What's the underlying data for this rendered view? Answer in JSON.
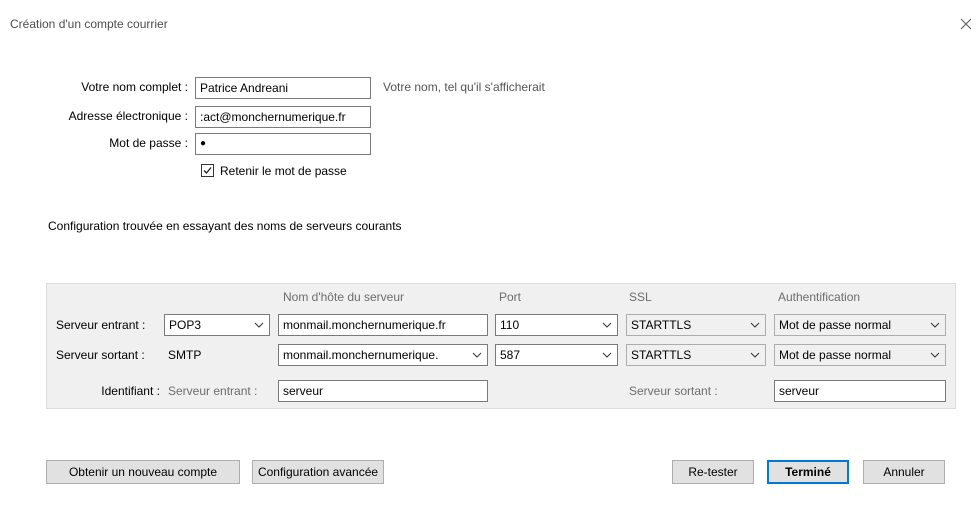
{
  "window": {
    "title": "Création d'un compte courrier"
  },
  "form": {
    "name_label": "Votre nom complet :",
    "name_value": "Patrice Andreani",
    "name_hint": "Votre nom, tel qu'il s'afficherait",
    "email_label": "Adresse électronique :",
    "email_value": ":act@monchernumerique.fr",
    "password_label": "Mot de passe :",
    "password_value": "●",
    "remember_label": "Retenir le mot de passe",
    "remember_checked": true
  },
  "status_message": "Configuration trouvée en essayant des noms de serveurs courants",
  "servers": {
    "headers": {
      "hostname": "Nom d'hôte du serveur",
      "port": "Port",
      "ssl": "SSL",
      "auth": "Authentification"
    },
    "incoming": {
      "label": "Serveur entrant :",
      "protocol": "POP3",
      "hostname": "monmail.monchernumerique.fr",
      "port": "110",
      "ssl": "STARTTLS",
      "auth": "Mot de passe normal"
    },
    "outgoing": {
      "label": "Serveur sortant :",
      "protocol": "SMTP",
      "hostname": "monmail.monchernumerique.",
      "port": "587",
      "ssl": "STARTTLS",
      "auth": "Mot de passe normal"
    },
    "identifier": {
      "label": "Identifiant :",
      "incoming_label": "Serveur entrant :",
      "incoming_value": "serveur",
      "outgoing_label": "Serveur sortant :",
      "outgoing_value": "serveur"
    }
  },
  "buttons": {
    "new_account": "Obtenir un nouveau compte",
    "advanced": "Configuration avancée",
    "retest": "Re-tester",
    "done": "Terminé",
    "cancel": "Annuler"
  },
  "icons": {
    "close": "close-icon",
    "dropdown": "chevron-down-icon",
    "checkbox": "checkmark-icon"
  }
}
